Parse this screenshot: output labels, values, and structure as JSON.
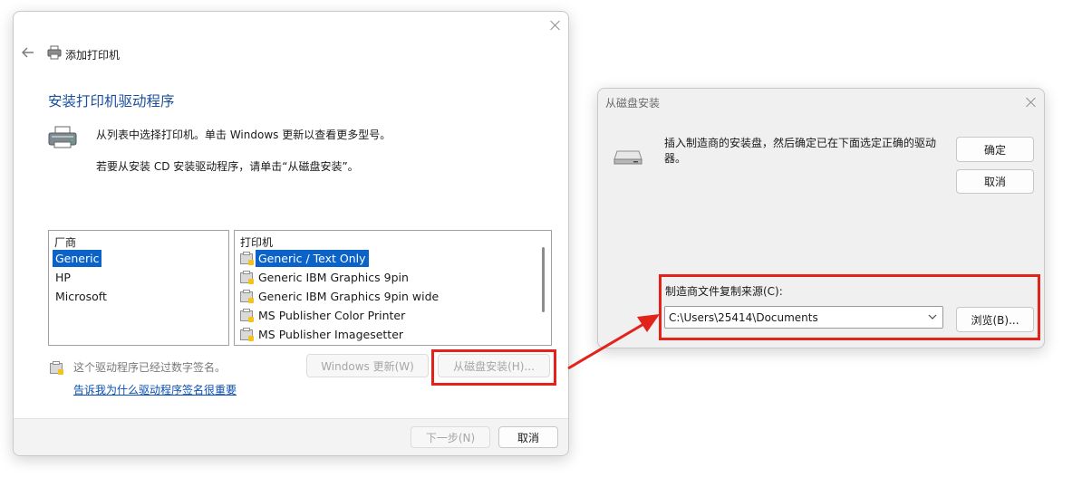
{
  "wizard": {
    "header_title": "添加打印机",
    "heading": "安装打印机驱动程序",
    "desc_line1": "从列表中选择打印机。单击 Windows 更新以查看更多型号。",
    "desc_line2": "若要从安装 CD 安装驱动程序，请单击“从磁盘安装”。",
    "manufacturer_header": "厂商",
    "manufacturers": [
      "Generic",
      "HP",
      "Microsoft"
    ],
    "selected_manufacturer": "Generic",
    "printer_header": "打印机",
    "printers": [
      "Generic / Text Only",
      "Generic IBM Graphics 9pin",
      "Generic IBM Graphics 9pin wide",
      "MS Publisher Color Printer",
      "MS Publisher Imagesetter"
    ],
    "selected_printer": "Generic / Text Only",
    "signed_note": "这个驱动程序已经过数字签名。",
    "why_link": "告诉我为什么驱动程序签名很重要",
    "windows_update_button": "Windows 更新(W)",
    "have_disk_button": "从磁盘安装(H)...",
    "next_button": "下一步(N)",
    "cancel_button": "取消"
  },
  "disk_dialog": {
    "title": "从磁盘安装",
    "instruction": "插入制造商的安装盘，然后确定已在下面选定正确的驱动器。",
    "ok_button": "确定",
    "cancel_button": "取消",
    "source_label": "制造商文件复制来源(C):",
    "source_value": "C:\\Users\\25414\\Documents",
    "browse_button": "浏览(B)..."
  },
  "colors": {
    "accent_blue": "#0b63c9",
    "heading_blue": "#1b4f9c",
    "link_blue": "#0a4fb4",
    "annotation_red": "#e2231a"
  }
}
